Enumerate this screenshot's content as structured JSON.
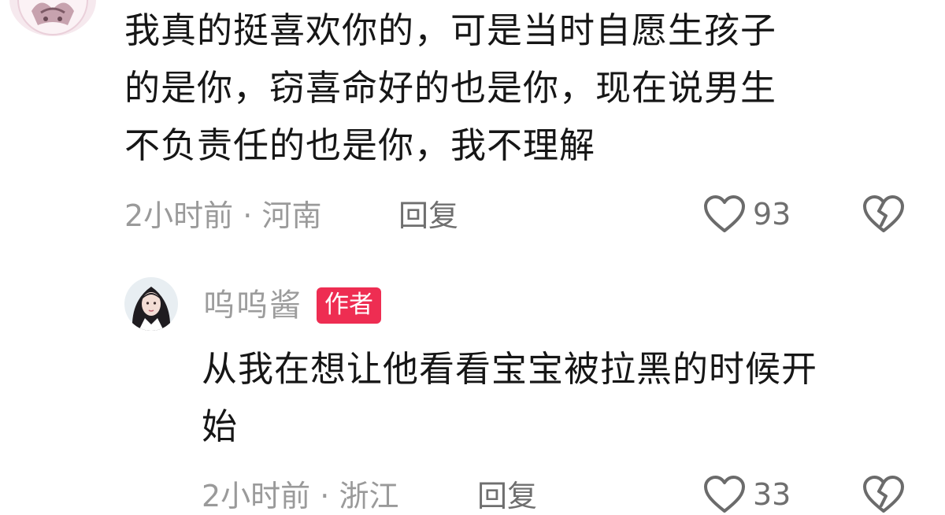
{
  "comments": [
    {
      "text": "我真的挺喜欢你的，可是当时自愿生孩子的是你，窃喜命好的也是你，现在说男生不负责任的也是你，我不理解",
      "lines": [
        "我真的挺喜欢你的，可是当时自愿生孩子",
        "的是你，窃喜命好的也是你，现在说男生",
        "不负责任的也是你，我不理解"
      ],
      "time": "2小时前",
      "separator": "·",
      "location": "河南",
      "reply_label": "回复",
      "likes": "93",
      "avatar_icon": "avatar-icon"
    },
    {
      "username": "呜呜酱",
      "badge": "作者",
      "lines": [
        "从我在想让他看看宝宝被拉黑的时候开",
        "始"
      ],
      "time": "2小时前",
      "separator": "·",
      "location": "浙江",
      "reply_label": "回复",
      "likes": "33",
      "avatar_icon": "avatar-icon"
    }
  ],
  "icons": {
    "like": "heart-icon",
    "dislike": "broken-heart-icon"
  },
  "colors": {
    "badge": "#ee2d52",
    "meta": "#9a9a9a",
    "text": "#161616"
  }
}
